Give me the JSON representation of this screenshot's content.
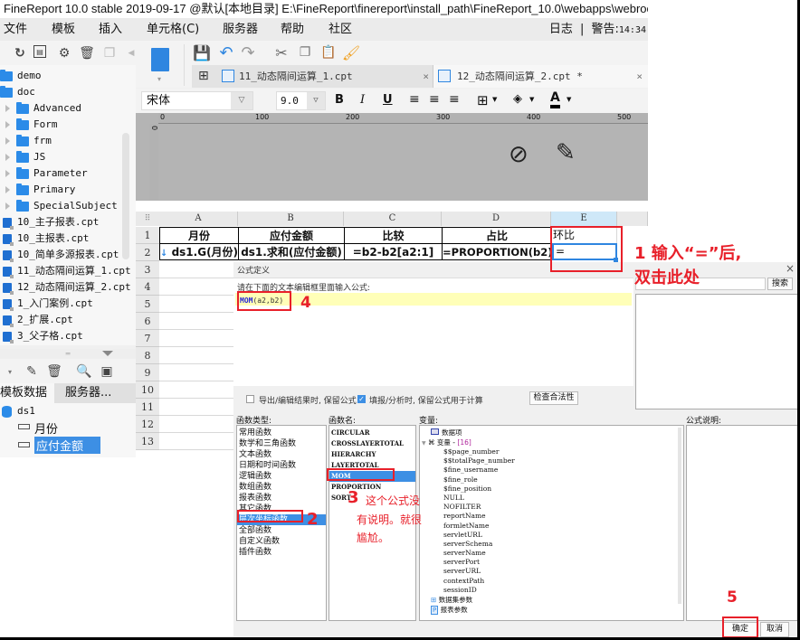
{
  "window": {
    "title": "FineReport 10.0 stable 2019-09-17 @默认[本地目录]     E:\\FineReport\\finereport\\install_path\\FineReport_10.0\\webapps\\webroot"
  },
  "menu": {
    "items": [
      "文件",
      "模板",
      "插入",
      "单元格(C)",
      "服务器",
      "帮助",
      "社区"
    ],
    "log_label": "日志",
    "separator": "|",
    "warning_label": "警告:",
    "time": "14:34"
  },
  "tree": {
    "folders_top": [
      "demo",
      "doc"
    ],
    "subfolders": [
      "Advanced",
      "Form",
      "frm",
      "JS",
      "Parameter",
      "Primary",
      "SpecialSubject"
    ],
    "files": [
      "10_主子报表.cpt",
      "10_主报表.cpt",
      "10_简单多源报表.cpt",
      "11_动态隔间运算_1.cpt",
      "12_动态隔间运算_2.cpt",
      "1_入门案例.cpt",
      "2_扩展.cpt",
      "3_父子格.cpt"
    ]
  },
  "dataset_panel": {
    "tabs": [
      "模板数据集",
      "服务器..."
    ],
    "dataset": "ds1",
    "fields": [
      "月份",
      "应付金额"
    ],
    "selected_field": "应付金额"
  },
  "doc_tabs": [
    {
      "label": "11_动态隔间运算_1.cpt",
      "active": false
    },
    {
      "label": "12_动态隔间运算_2.cpt *",
      "active": true
    }
  ],
  "format_bar": {
    "font": "宋体",
    "size": "9.0",
    "bold": "B",
    "italic": "I",
    "underline": "U",
    "font_color_glyph": "A"
  },
  "ruler": {
    "h_ticks": [
      "0",
      "100",
      "200",
      "300",
      "400",
      "500"
    ],
    "v_tick": "0"
  },
  "sheet": {
    "columns": [
      "A",
      "B",
      "C",
      "D",
      "E"
    ],
    "rows": [
      "1",
      "2",
      "3",
      "4",
      "5",
      "6",
      "7",
      "8",
      "9",
      "10",
      "11",
      "12",
      "13"
    ],
    "row1": [
      "月份",
      "应付金额",
      "比较",
      "占比",
      "环比"
    ],
    "row2": [
      "ds1.G(月份)",
      "ds1.求和(应付金额)",
      "=b2-b2[a2:1]",
      "=PROPORTION(b2)",
      "="
    ]
  },
  "dialog": {
    "title": "公式定义",
    "prompt": "请在下面的文本编辑框里面输入公式:",
    "formula_fn": "MOM",
    "formula_args": "(a2,b2)",
    "search_button": "搜索",
    "checkbox_export": {
      "label": "导出/编辑结果时, 保留公式",
      "checked": false
    },
    "checkbox_fill": {
      "label": "填报/分析时, 保留公式用于计算",
      "checked": true
    },
    "check_button": "检查合法性",
    "function_types_label": "函数类型:",
    "function_types": [
      "常用函数",
      "数学和三角函数",
      "文本函数",
      "日期和时间函数",
      "逻辑函数",
      "数组函数",
      "报表函数",
      "其它函数",
      "层次坐标函数",
      "全部函数",
      "自定义函数",
      "插件函数"
    ],
    "selected_type": "层次坐标函数",
    "function_names_label": "函数名:",
    "function_names": [
      "CIRCULAR",
      "CROSSLAYERTOTAL",
      "HIERARCHY",
      "LAYERTOTAL",
      "MOM",
      "PROPORTION",
      "SORT"
    ],
    "selected_name": "MOM",
    "variables_label": "变量:",
    "variables_root1": "数据项",
    "variables_group": "变量 - ",
    "variables_count": "[16]",
    "variables": [
      "$$page_number",
      "$$totalPage_number",
      "$fine_username",
      "$fine_role",
      "$fine_position",
      "NULL",
      "NOFILTER",
      "reportName",
      "formletName",
      "servletURL",
      "serverSchema",
      "serverName",
      "serverPort",
      "serverURL",
      "contextPath",
      "sessionID"
    ],
    "variables_root2": "数据集参数",
    "variables_root3": "报表参数",
    "description_label": "公式说明:",
    "ok_button": "确定",
    "cancel_button": "取消"
  },
  "annotations": {
    "step1_line1": "1 输入“=”后,",
    "step1_line2": "双击此处",
    "step2": "2",
    "step3_num": "3",
    "step3_text1": "这个公式没",
    "step3_text2": "有说明。就很",
    "step3_text3": "尴尬。",
    "step4": "4",
    "step5": "5"
  },
  "colors": {
    "accent_blue": "#3d8fe4",
    "annotation_red": "#e8202a",
    "folder_blue": "#2b8be8"
  }
}
